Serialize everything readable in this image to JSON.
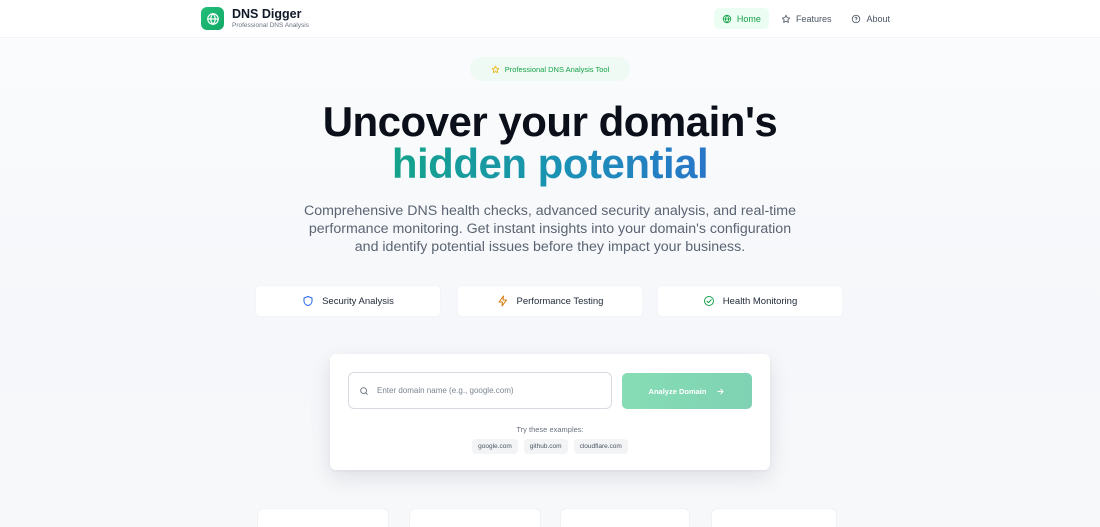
{
  "header": {
    "brand_title": "DNS Digger",
    "brand_subtitle": "Professional DNS Analysis",
    "nav": [
      {
        "label": "Home",
        "icon": "globe-icon",
        "active": true
      },
      {
        "label": "Features",
        "icon": "star-icon",
        "active": false
      },
      {
        "label": "About",
        "icon": "help-circle-icon",
        "active": false
      }
    ]
  },
  "hero": {
    "badge": "Professional DNS Analysis Tool",
    "title_line1": "Uncover your domain's",
    "title_line2": "hidden potential",
    "description": "Comprehensive DNS health checks, advanced security analysis, and real-time performance monitoring. Get instant insights into your domain's configuration and identify potential issues before they impact your business."
  },
  "features": [
    {
      "label": "Security Analysis",
      "icon": "shield-icon"
    },
    {
      "label": "Performance Testing",
      "icon": "zap-icon"
    },
    {
      "label": "Health Monitoring",
      "icon": "check-circle-icon"
    }
  ],
  "search": {
    "placeholder": "Enter domain name (e.g., google.com)",
    "value": "",
    "button_label": "Analyze Domain",
    "examples_label": "Try these examples:",
    "examples": [
      "google.com",
      "github.com",
      "cloudflare.com"
    ]
  },
  "colors": {
    "brand": "#16a34a",
    "gradient_start": "#14a38b",
    "gradient_end": "#2876c9",
    "button": "#86ddb5"
  }
}
